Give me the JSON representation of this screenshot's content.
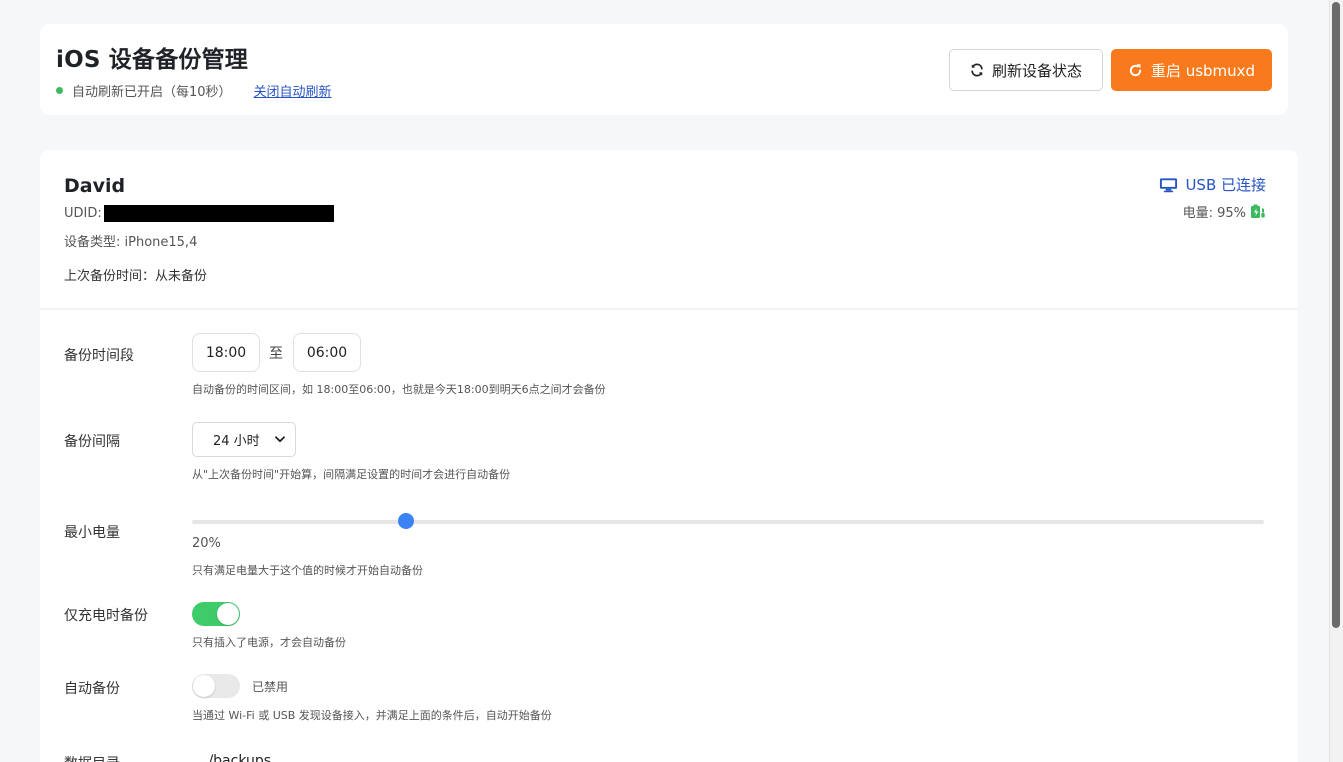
{
  "header": {
    "title": "iOS 设备备份管理",
    "auto_refresh_status": "自动刷新已开启（每10秒）",
    "close_auto_refresh": "关闭自动刷新",
    "refresh_button": "刷新设备状态",
    "restart_button": "重启 usbmuxd"
  },
  "device": {
    "name": "David",
    "udid_label": "UDID:",
    "type": "设备类型: iPhone15,4",
    "last_backup": "上次备份时间：从未备份",
    "connection": "USB 已连接",
    "battery": "电量: 95%"
  },
  "settings": {
    "time_range": {
      "label": "备份时间段",
      "start": "18:00",
      "separator": "至",
      "end": "06:00",
      "help": "自动备份的时间区间，如 18:00至06:00，也就是今天18:00到明天6点之间才会备份"
    },
    "interval": {
      "label": "备份间隔",
      "value": "24 小时",
      "help": "从\"上次备份时间\"开始算，间隔满足设置的时间才会进行自动备份"
    },
    "min_battery": {
      "label": "最小电量",
      "value": 20,
      "value_text": "20%",
      "help": "只有满足电量大于这个值的时候才开始自动备份"
    },
    "charging_only": {
      "label": "仅充电时备份",
      "enabled": true,
      "help": "只有插入了电源，才会自动备份"
    },
    "auto_backup": {
      "label": "自动备份",
      "enabled": false,
      "state_text": "已禁用",
      "help": "当通过 Wi-Fi 或 USB 发现设备接入，并满足上面的条件后，自动开始备份"
    },
    "data_dir": {
      "label": "数据目录",
      "value": "./backups"
    }
  },
  "colors": {
    "accent_orange": "#f97a1c",
    "link_blue": "#2754c5",
    "toggle_green": "#3ecb6a",
    "slider_blue": "#3b82f6"
  },
  "icons": {
    "refresh": "refresh-icon",
    "restart": "restart-icon",
    "monitor": "monitor-icon",
    "battery": "battery-charging-icon"
  }
}
